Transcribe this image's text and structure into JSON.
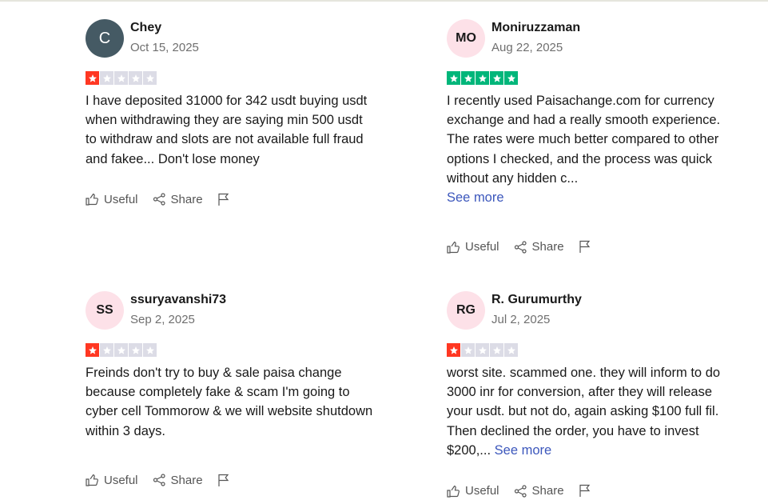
{
  "colors": {
    "star_red": "#ff3722",
    "star_green": "#00b67a",
    "star_empty": "#dcdce6",
    "link": "#3c57bc",
    "avatar_pink": "#fde1e8",
    "avatar_dark": "#455a64"
  },
  "actions": {
    "useful": "Useful",
    "share": "Share"
  },
  "reviews": [
    {
      "initials": "C",
      "name": "Chey",
      "date": "Oct 15, 2025",
      "rating": 1,
      "text": "I have deposited 31000 for 342 usdt buying usdt when withdrawing they are saying min 500 usdt to withdraw and slots are not available full fraud and fakee... Don't lose money",
      "see_more": ""
    },
    {
      "initials": "MO",
      "name": "Moniruzzaman",
      "date": "Aug 22, 2025",
      "rating": 5,
      "text": "I recently used Paisachange.com for currency exchange and had a really smooth experience. The rates were much better compared to other options I checked, and the process was quick without any hidden c...",
      "see_more": "See more"
    },
    {
      "initials": "SS",
      "name": "ssuryavanshi73",
      "date": "Sep 2, 2025",
      "rating": 1,
      "text": "Freinds don't try to buy & sale paisa change because completely fake & scam I'm going to cyber cell Tommorow & we will website shutdown within 3 days.",
      "see_more": ""
    },
    {
      "initials": "RG",
      "name": "R. Gurumurthy",
      "date": "Jul 2, 2025",
      "rating": 1,
      "text": "worst site. scammed one. they will inform to do 3000 inr for conversion, after they will release your usdt. but not do, again asking $100 full fil. Then declined the order, you have to invest $200,...",
      "see_more": "See more"
    }
  ]
}
